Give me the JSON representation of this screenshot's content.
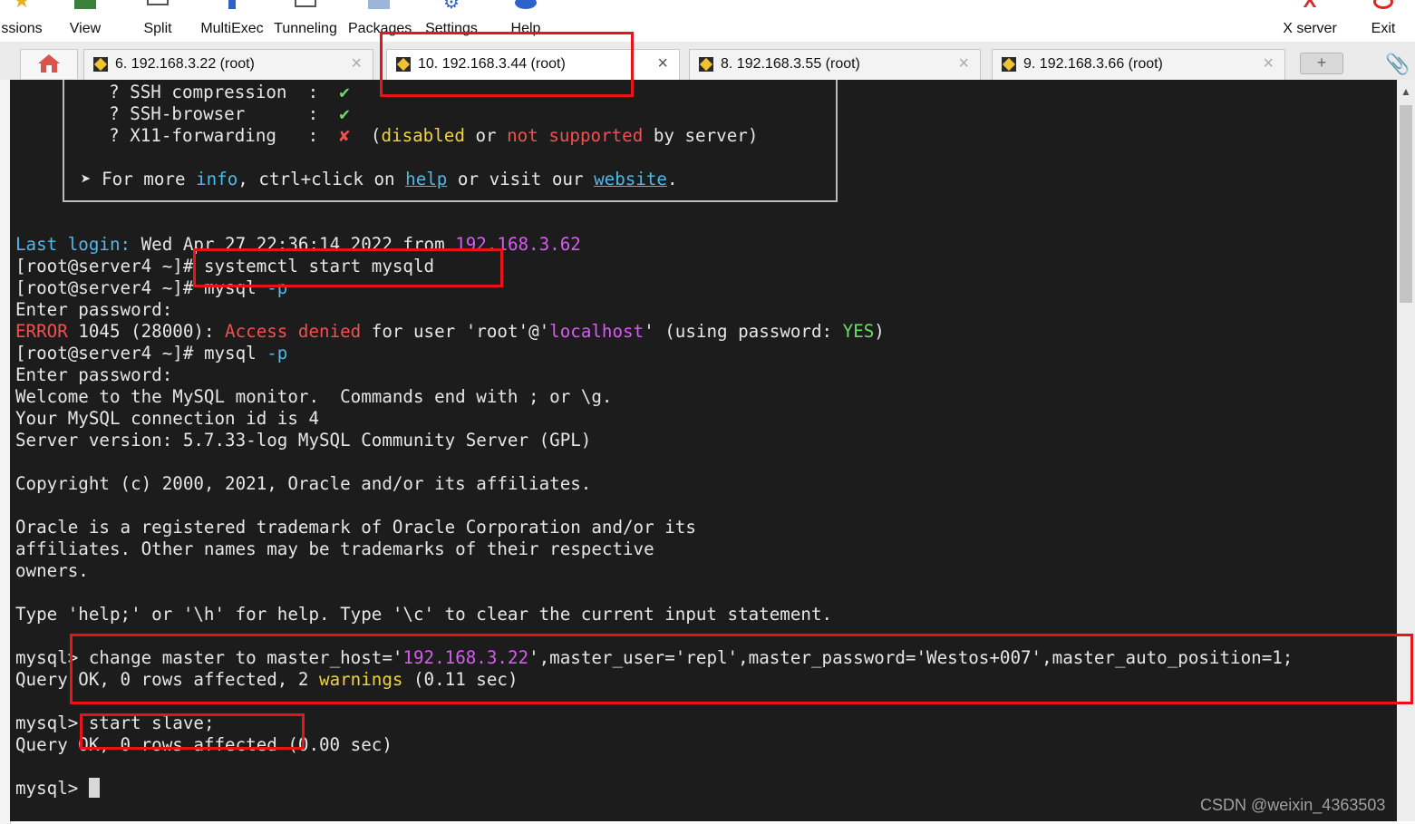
{
  "toolbar": {
    "sessions": "ssions",
    "view": "View",
    "split": "Split",
    "multiexec": "MultiExec",
    "tunneling": "Tunneling",
    "packages": "Packages",
    "settings": "Settings",
    "help": "Help",
    "xserver": "X server",
    "exit": "Exit"
  },
  "tabs": [
    {
      "title": "6. 192.168.3.22 (root)"
    },
    {
      "title": "10. 192.168.3.44 (root)",
      "active": true
    },
    {
      "title": "8. 192.168.3.55 (root)"
    },
    {
      "title": "9. 192.168.3.66 (root)"
    }
  ],
  "terminal": {
    "banner": {
      "ssh_compression": "  ? SSH compression  :  ",
      "ssh_browser": "  ? SSH-browser      :  ",
      "x11_forwarding": "  ? X11-forwarding   :  ",
      "check": "✔",
      "cross": "✘",
      "paren_open": "  (",
      "disabled": "disabled",
      "or": " or ",
      "not_supported": "not supported",
      "by_server": " by server)",
      "more_prefix": "➤ For more ",
      "info": "info",
      "ctrl_click": ", ctrl+click on ",
      "help": "help",
      "or_visit": " or visit our ",
      "website": "website",
      "period": "."
    },
    "last_login_label": "Last login:",
    "last_login_text": " Wed Apr 27 22:36:14 2022 from ",
    "last_login_ip": "192.168.3.62",
    "prompt": "[root@server4 ~]# ",
    "cmd_systemctl": "systemctl start mysqld",
    "cmd_mysql": "mysql ",
    "flag_p": "-p",
    "enter_password": "Enter password:",
    "error_word": "ERROR",
    "error_code": " 1045 (28000): ",
    "access_denied": "Access denied",
    "for_user": " for user 'root'@'",
    "localhost": "localhost",
    "using_password": "' (using password: ",
    "yes": "YES",
    "close_paren": ")",
    "welcome": "Welcome to the MySQL monitor.  Commands end with ; or \\g.",
    "conn_id": "Your MySQL connection id is 4",
    "server_version": "Server version: 5.7.33-log MySQL Community Server (GPL)",
    "copyright": "Copyright (c) 2000, 2021, Oracle and/or its affiliates.",
    "oracle1": "Oracle is a registered trademark of Oracle Corporation and/or its",
    "oracle2": "affiliates. Other names may be trademarks of their respective",
    "oracle3": "owners.",
    "type_help": "Type 'help;' or '\\h' for help. Type '\\c' to clear the current input statement.",
    "mysql_prompt": "mysql> ",
    "change_master_a": "change master to master_host='",
    "master_host_ip": "192.168.3.22",
    "change_master_b": "',master_user='repl',master_password='Westos+007',master_auto_position=1;",
    "query_ok_a": "Query OK, 0 rows affected, 2 ",
    "warnings": "warnings",
    "query_ok_b": " (0.11 sec)",
    "start_slave": "start slave;",
    "query_ok_slave": "Query OK, 0 rows affected (0.00 sec)"
  },
  "watermark": "CSDN @weixin_4363503"
}
